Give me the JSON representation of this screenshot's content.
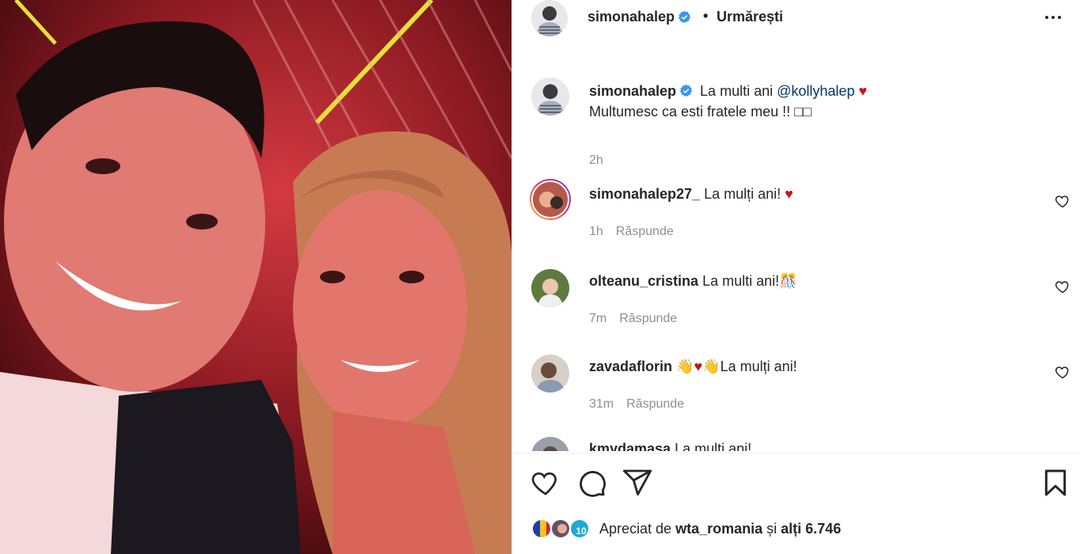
{
  "post": {
    "author": "simonahalep",
    "separator": "•",
    "follow_label": "Urmărești",
    "caption_line1": "La multi ani",
    "caption_mention": "@kollyhalep",
    "caption_heart": "♥",
    "caption_line2": "Multumesc ca esti fratele meu !! □□",
    "caption_time": "2h"
  },
  "comments": [
    {
      "user": "simonahalep27_",
      "text": "La mulți ani!",
      "emoji": "♥",
      "time": "1h",
      "reply_label": "Răspunde"
    },
    {
      "user": "olteanu_cristina",
      "text": "La multi ani!",
      "emoji": "🎊",
      "time": "7m",
      "reply_label": "Răspunde"
    },
    {
      "user": "zavadaflorin",
      "emoji_prefix": "👋♥👋",
      "text": "La mulți ani!",
      "time": "31m",
      "reply_label": "Răspunde"
    },
    {
      "user": "kmydamasa",
      "text": "La multi ani!"
    }
  ],
  "likes": {
    "prefix": "Apreciat de",
    "user": "wta_romania",
    "middle": "și",
    "others": "alți 6.746"
  },
  "icons": {
    "more": "more-horizontal-icon",
    "like": "heart-icon",
    "comment": "comment-icon",
    "share": "paper-plane-icon",
    "save": "bookmark-icon",
    "verified": "verified-badge-icon"
  },
  "colors": {
    "verified": "#3897f0",
    "heart": "#c4161c",
    "mention": "#00376b",
    "muted": "#8e8e8e"
  }
}
